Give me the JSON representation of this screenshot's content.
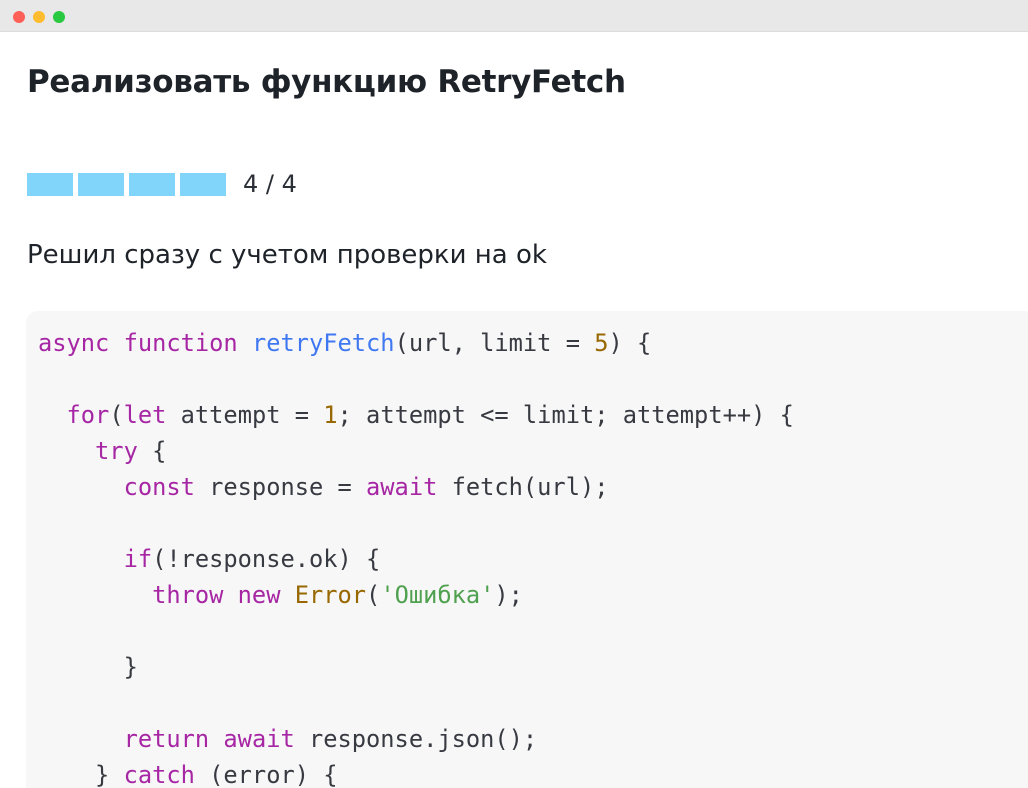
{
  "page": {
    "title": "Реализовать функцию RetryFetch",
    "answer_text": "Решил сразу с учетом проверки на ok"
  },
  "progress": {
    "completed": 4,
    "total": 4,
    "label": "4 / 4",
    "segment_color": "#81d4fa"
  },
  "colors": {
    "keyword": "#a626a4",
    "function": "#4078f2",
    "number": "#986801",
    "string": "#50a14f",
    "text": "#383a42",
    "code_background": "#f7f7f7"
  },
  "code": {
    "language": "javascript",
    "lines": [
      [
        {
          "t": "kw",
          "v": "async"
        },
        {
          "t": "plain",
          "v": " "
        },
        {
          "t": "kw",
          "v": "function"
        },
        {
          "t": "plain",
          "v": " "
        },
        {
          "t": "fn",
          "v": "retryFetch"
        },
        {
          "t": "plain",
          "v": "(url, limit = "
        },
        {
          "t": "num",
          "v": "5"
        },
        {
          "t": "plain",
          "v": ") {"
        }
      ],
      [],
      [
        {
          "t": "plain",
          "v": "  "
        },
        {
          "t": "kw",
          "v": "for"
        },
        {
          "t": "plain",
          "v": "("
        },
        {
          "t": "kw",
          "v": "let"
        },
        {
          "t": "plain",
          "v": " attempt = "
        },
        {
          "t": "num",
          "v": "1"
        },
        {
          "t": "plain",
          "v": "; attempt <= limit; attempt++) {"
        }
      ],
      [
        {
          "t": "plain",
          "v": "    "
        },
        {
          "t": "kw",
          "v": "try"
        },
        {
          "t": "plain",
          "v": " {"
        }
      ],
      [
        {
          "t": "plain",
          "v": "      "
        },
        {
          "t": "kw",
          "v": "const"
        },
        {
          "t": "plain",
          "v": " response = "
        },
        {
          "t": "kw",
          "v": "await"
        },
        {
          "t": "plain",
          "v": " fetch(url);"
        }
      ],
      [],
      [
        {
          "t": "plain",
          "v": "      "
        },
        {
          "t": "kw",
          "v": "if"
        },
        {
          "t": "plain",
          "v": "(!response.ok) {"
        }
      ],
      [
        {
          "t": "plain",
          "v": "        "
        },
        {
          "t": "kw",
          "v": "throw"
        },
        {
          "t": "plain",
          "v": " "
        },
        {
          "t": "kw",
          "v": "new"
        },
        {
          "t": "plain",
          "v": " "
        },
        {
          "t": "cls",
          "v": "Error"
        },
        {
          "t": "plain",
          "v": "("
        },
        {
          "t": "str",
          "v": "'Ошибка'"
        },
        {
          "t": "plain",
          "v": ");"
        }
      ],
      [],
      [
        {
          "t": "plain",
          "v": "      }"
        }
      ],
      [],
      [
        {
          "t": "plain",
          "v": "      "
        },
        {
          "t": "kw",
          "v": "return"
        },
        {
          "t": "plain",
          "v": " "
        },
        {
          "t": "kw",
          "v": "await"
        },
        {
          "t": "plain",
          "v": " response.json();"
        }
      ],
      [
        {
          "t": "plain",
          "v": "    } "
        },
        {
          "t": "kw",
          "v": "catch"
        },
        {
          "t": "plain",
          "v": " (error) {"
        }
      ]
    ]
  }
}
